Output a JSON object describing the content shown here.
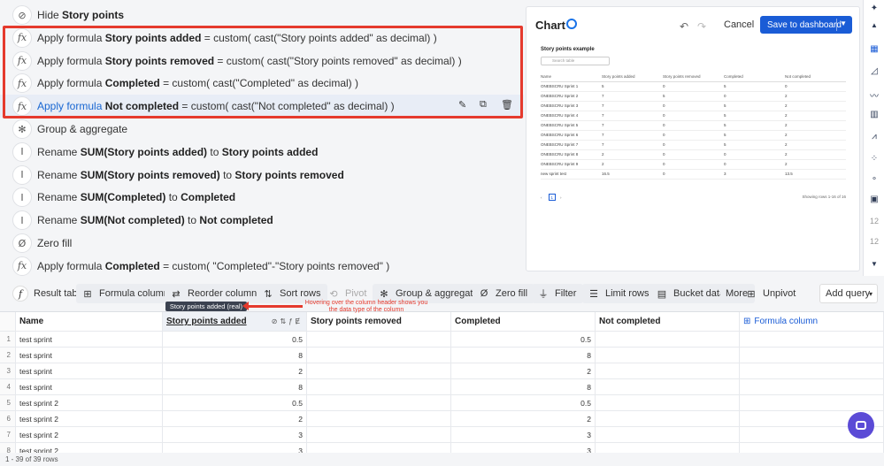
{
  "steps": [
    {
      "kind": "hide",
      "prefix": "Hide",
      "bold": "Story points",
      "suffix": ""
    },
    {
      "kind": "formula",
      "prefix": "Apply formula",
      "bold": "Story points added",
      "suffix": "= custom( cast(\"Story points added\" as decimal) )"
    },
    {
      "kind": "formula",
      "prefix": "Apply formula",
      "bold": "Story points removed",
      "suffix": "= custom( cast(\"Story points removed\" as decimal) )"
    },
    {
      "kind": "formula",
      "prefix": "Apply formula",
      "bold": "Completed",
      "suffix": "= custom( cast(\"Completed\" as decimal) )"
    },
    {
      "kind": "formula",
      "prefix": "Apply formula",
      "bold": "Not completed",
      "suffix": "= custom( cast(\"Not completed\" as decimal) )"
    },
    {
      "kind": "group",
      "prefix": "Group & aggregate",
      "bold": "",
      "suffix": ""
    },
    {
      "kind": "rename",
      "prefix": "Rename",
      "bold": "SUM(Story points added)",
      "mid": "to",
      "bold2": "Story points added"
    },
    {
      "kind": "rename",
      "prefix": "Rename",
      "bold": "SUM(Story points removed)",
      "mid": "to",
      "bold2": "Story points removed"
    },
    {
      "kind": "rename",
      "prefix": "Rename",
      "bold": "SUM(Completed)",
      "mid": "to",
      "bold2": "Completed"
    },
    {
      "kind": "rename",
      "prefix": "Rename",
      "bold": "SUM(Not completed)",
      "mid": "to",
      "bold2": "Not completed"
    },
    {
      "kind": "zero",
      "prefix": "Zero fill",
      "bold": "",
      "suffix": ""
    },
    {
      "kind": "formula",
      "prefix": "Apply formula",
      "bold": "Completed",
      "suffix": "= custom( \"Completed\"-\"Story points removed\" )"
    }
  ],
  "chart": {
    "title": "Chart",
    "cancel": "Cancel",
    "save": "Save to dashboard",
    "mini_title": "Story points example",
    "mini_search": "Search table",
    "mini_headers": [
      "Name",
      "Story points added",
      "Story points removed",
      "Completed",
      "Not completed"
    ],
    "mini_rows": [
      [
        "ONEBSCRU Sprint 1",
        "5",
        "0",
        "5",
        "0"
      ],
      [
        "ONEBSCRU Sprint 2",
        "7",
        "5",
        "0",
        "2"
      ],
      [
        "ONEBSCRU Sprint 3",
        "7",
        "0",
        "5",
        "2"
      ],
      [
        "ONEBSCRU Sprint 4",
        "7",
        "0",
        "5",
        "2"
      ],
      [
        "ONEBSCRU Sprint 5",
        "7",
        "0",
        "5",
        "2"
      ],
      [
        "ONEBSCRU Sprint 6",
        "7",
        "0",
        "5",
        "2"
      ],
      [
        "ONEBSCRU Sprint 7",
        "7",
        "0",
        "5",
        "2"
      ],
      [
        "ONEBSCRU Sprint 8",
        "2",
        "0",
        "0",
        "2"
      ],
      [
        "ONEBSCRU Sprint 9",
        "2",
        "0",
        "0",
        "2"
      ],
      [
        "new sprint test",
        "16.5",
        "0",
        "3",
        "13.5"
      ]
    ],
    "page": "1",
    "showing": "Showing rows 1-16 of 16"
  },
  "vtool": {
    "num1": "12",
    "num2": "12"
  },
  "toolbar": {
    "result_table": "Result table",
    "formula_column": "Formula column",
    "reorder_columns": "Reorder columns",
    "sort_rows": "Sort rows",
    "pivot": "Pivot",
    "group_aggregate": "Group & aggregate",
    "zero_fill": "Zero fill",
    "filter": "Filter",
    "limit_rows": "Limit rows",
    "bucket_data": "Bucket data",
    "more": "More",
    "unpivot": "Unpivot",
    "add_query": "Add query"
  },
  "tooltip": "Story points added (real)",
  "annotation": "Hovering over the column header shows you the data type of the column",
  "table": {
    "headers": [
      "Name",
      "Story points added",
      "Story points removed",
      "Completed",
      "Not completed",
      "Formula column"
    ],
    "rows": [
      [
        "1",
        "test sprint",
        "0.5",
        "",
        "0.5",
        ""
      ],
      [
        "2",
        "test sprint",
        "8",
        "",
        "8",
        ""
      ],
      [
        "3",
        "test sprint",
        "2",
        "",
        "2",
        ""
      ],
      [
        "4",
        "test sprint",
        "8",
        "",
        "8",
        ""
      ],
      [
        "5",
        "test sprint 2",
        "0.5",
        "",
        "0.5",
        ""
      ],
      [
        "6",
        "test sprint 2",
        "2",
        "",
        "2",
        ""
      ],
      [
        "7",
        "test sprint 2",
        "3",
        "",
        "3",
        ""
      ],
      [
        "8",
        "test sprint 2",
        "3",
        "",
        "3",
        ""
      ]
    ],
    "row_count": "1 - 39 of 39 rows"
  }
}
